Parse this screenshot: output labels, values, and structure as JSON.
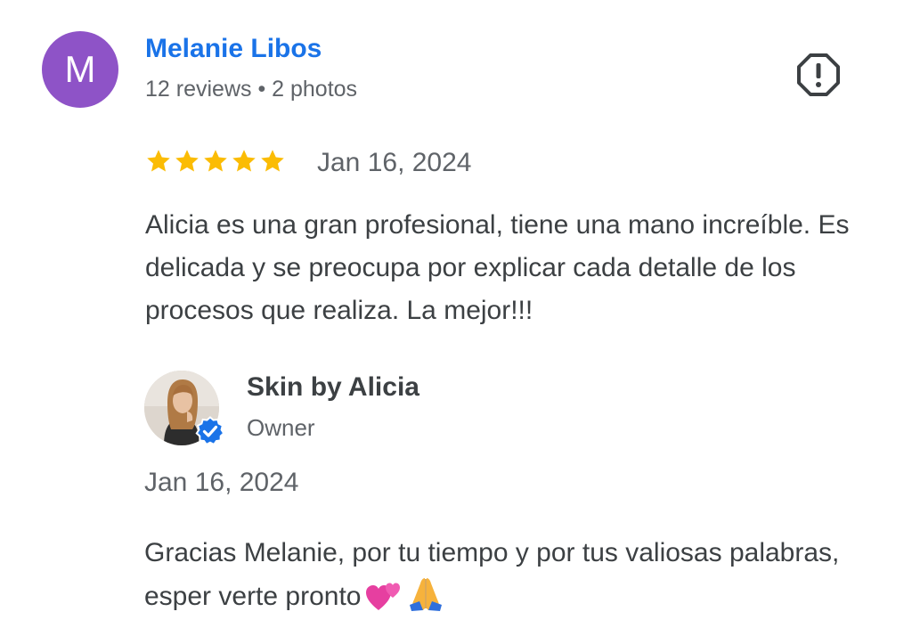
{
  "review": {
    "reviewer": {
      "initial": "M",
      "avatar_color": "#8e53c7",
      "name": "Melanie Libos",
      "meta": "12 reviews • 2 photos"
    },
    "report_icon": "report-flag-icon",
    "rating": 5,
    "date": "Jan 16, 2024",
    "text": "Alicia es una gran profesional, tiene una mano increíble. Es delicada y se preocupa por explicar cada detalle de los procesos que realiza. La mejor!!!"
  },
  "owner_reply": {
    "name": "Skin by Alicia",
    "role": "Owner",
    "verified_icon": "verified-check-icon",
    "date": "Jan 16, 2024",
    "text": "Gracias Melanie, por tu tiempo y por tus valiosas palabras, esper verte pronto",
    "emojis": [
      "two-hearts-emoji",
      "folded-hands-emoji"
    ]
  },
  "colors": {
    "link_blue": "#1a73e8",
    "star_yellow": "#fbbc04",
    "secondary_text": "#5f6368",
    "body_text": "#3c4043",
    "verified_blue": "#1a73e8"
  }
}
